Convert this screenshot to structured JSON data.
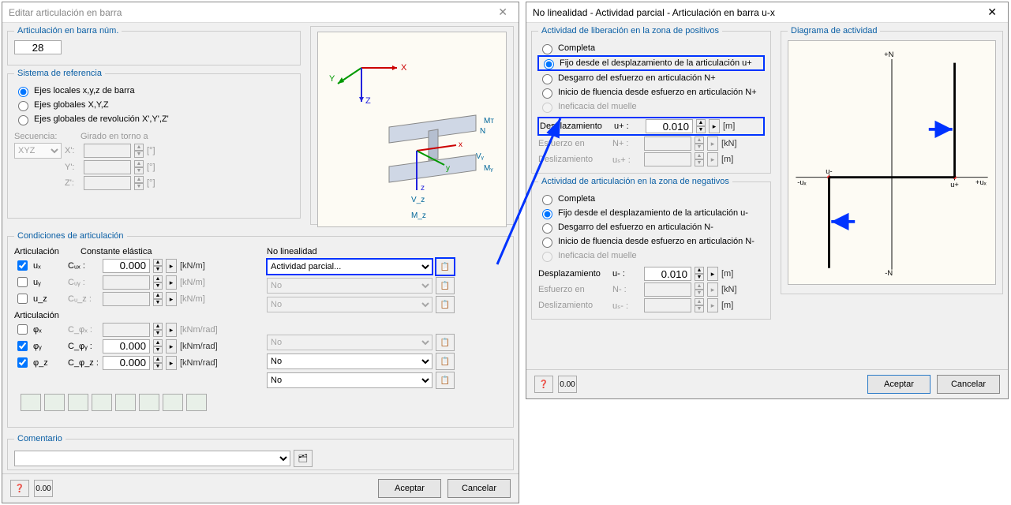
{
  "left": {
    "title": "Editar articulación en barra",
    "fs_num": {
      "legend": "Articulación en barra núm.",
      "value": "28"
    },
    "fs_ref": {
      "legend": "Sistema de referencia",
      "opt1": "Ejes locales x,y,z de barra",
      "opt2": "Ejes globales X,Y,Z",
      "opt3": "Ejes globales de revolución X',Y',Z'",
      "seq_label": "Secuencia:",
      "seq_value": "XYZ",
      "rot_label": "Girado en torno a",
      "rotX": "X':",
      "rotY": "Y':",
      "rotZ": "Z':",
      "deg": "[°]"
    },
    "fs_cond": {
      "legend": "Condiciones de articulación",
      "col_art": "Articulación",
      "col_const": "Constante elástica",
      "col_nonlin": "No linealidad",
      "ux": "uₓ",
      "uy": "uᵧ",
      "uz": "u_z",
      "cux": "Cᵤₓ :",
      "cuy": "Cᵤᵧ :",
      "cuz": "Cᵤ_z :",
      "val_ux": "0.000",
      "val_uy": "",
      "val_uz": "",
      "unit_lin": "[kN/m]",
      "rot_label": "Articulación",
      "phix": "φₓ",
      "phiy": "φᵧ",
      "phiz": "φ_z",
      "cphix": "C_φₓ :",
      "cphiy": "C_φᵧ :",
      "cphiz": "C_φ_z :",
      "val_phix": "",
      "val_phiy": "0.000",
      "val_phiz": "0.000",
      "unit_rot": "[kNm/rad]",
      "nonlin_ux": "Actividad parcial...",
      "nonlin_no": "No"
    },
    "comment": {
      "legend": "Comentario"
    },
    "buttons": {
      "ok": "Aceptar",
      "cancel": "Cancelar"
    }
  },
  "right": {
    "title": "No linealidad - Actividad parcial - Articulación en barra u-x",
    "fs_pos": {
      "legend": "Actividad de liberación en la zona de positivos",
      "opt1": "Completa",
      "opt2": "Fijo desde el desplazamiento de la articulación u+",
      "opt3": "Desgarro del esfuerzo en articulación N+",
      "opt4": "Inicio de fluencia desde esfuerzo en articulación N+",
      "opt5": "Ineficacia del muelle",
      "desp_label": "Desplazamiento",
      "desp_sym": "u+  :",
      "desp_val": "0.010",
      "desp_unit": "[m]",
      "esf_label": "Esfuerzo en",
      "esf_sym": "N+  :",
      "esf_unit": "[kN]",
      "desl_label": "Deslizamiento",
      "desl_sym": "uₛ+ :",
      "desl_unit": "[m]"
    },
    "fs_neg": {
      "legend": "Actividad de articulación en la zona de negativos",
      "opt1": "Completa",
      "opt2": "Fijo desde el desplazamiento de la articulación u-",
      "opt3": "Desgarro del esfuerzo en articulación N-",
      "opt4": "Inicio de fluencia desde esfuerzo en articulación N-",
      "opt5": "Ineficacia del muelle",
      "desp_label": "Desplazamiento",
      "desp_sym": "u-  :",
      "desp_val": "0.010",
      "desp_unit": "[m]",
      "esf_label": "Esfuerzo en",
      "esf_sym": "N-  :",
      "esf_unit": "[kN]",
      "desl_label": "Deslizamiento",
      "desl_sym": "uₛ- :",
      "desl_unit": "[m]"
    },
    "fs_diag": {
      "legend": "Diagrama de actividad",
      "nplus": "+N",
      "nminus": "-N",
      "uplus": "u+",
      "uminus": "u-",
      "uxp": "+uₓ",
      "uxn": "-uₓ"
    },
    "buttons": {
      "ok": "Aceptar",
      "cancel": "Cancelar"
    }
  }
}
